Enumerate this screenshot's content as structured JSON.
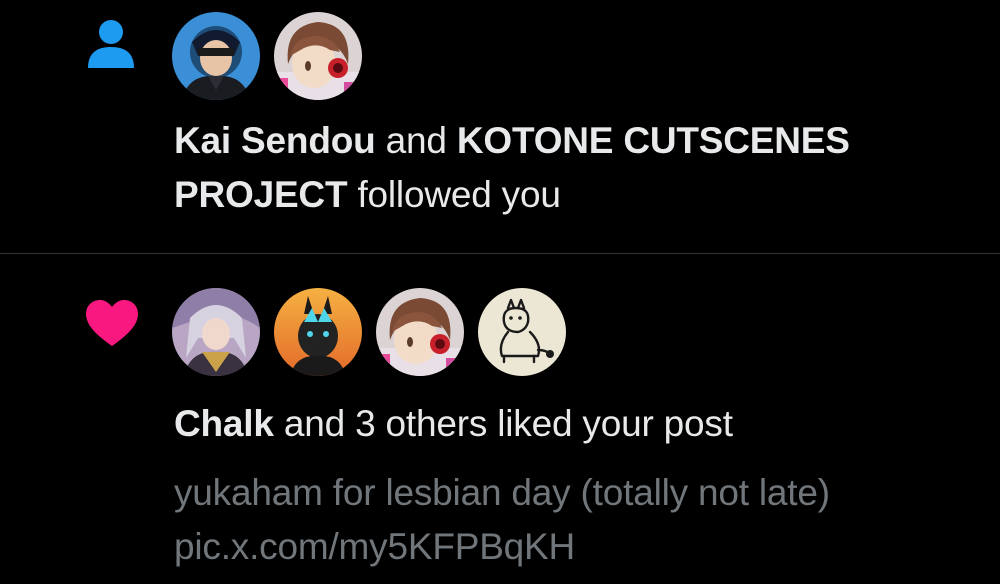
{
  "notifications": [
    {
      "type": "follow",
      "icon": "person-icon",
      "icon_color": "#1d9bf0",
      "users": [
        "Kai Sendou",
        "KOTONE CUTSCENES PROJECT"
      ],
      "connector": "and",
      "action": "followed you"
    },
    {
      "type": "like",
      "icon": "heart-icon",
      "icon_color": "#f91880",
      "user": "Chalk",
      "rest": "and 3 others liked your post",
      "post_text": "yukaham for lesbian day (totally not late)",
      "post_link": "pic.x.com/my5KFPBqKH"
    }
  ],
  "colors": {
    "background": "#000000",
    "primary_text": "#e7e9ea",
    "secondary_text": "#71767b",
    "divider": "#2f3336"
  }
}
